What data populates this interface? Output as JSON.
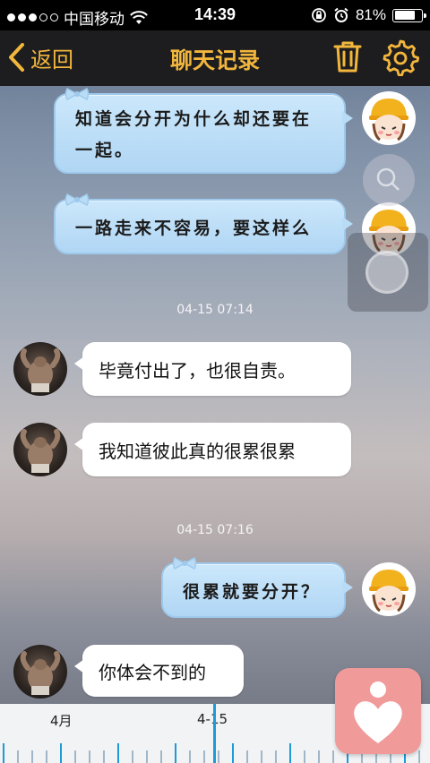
{
  "status_bar": {
    "carrier": "中国移动",
    "time": "14:39",
    "battery": "81%",
    "battery_level": 0.81
  },
  "nav": {
    "back_label": "返回",
    "title": "聊天记录"
  },
  "messages": [
    {
      "side": "right",
      "lines": [
        "知道会分开为什么却还要在",
        "一起。"
      ]
    },
    {
      "side": "right",
      "lines": [
        "一路走来不容易，要这样么"
      ]
    },
    {
      "side": "timestamp",
      "text": "04-15 07:14"
    },
    {
      "side": "left",
      "text": "毕竟付出了，也很自责。"
    },
    {
      "side": "left",
      "text": "我知道彼此真的很累很累"
    },
    {
      "side": "timestamp",
      "text": "04-15 07:16"
    },
    {
      "side": "right",
      "text": "很累就要分开？"
    },
    {
      "side": "left",
      "text": "你体会不到的"
    }
  ],
  "timeline": {
    "month_label": "4月",
    "date_label": "4-15"
  },
  "colors": {
    "accent": "#f2b63d",
    "nav_bg": "#1d1d1f",
    "bubble_right": "#b9dcf6",
    "timeline_cursor": "#1e9ad8",
    "heart_button": "#f09a9a"
  },
  "icons": {
    "back": "chevron-left-icon",
    "trash": "trash-icon",
    "settings": "gear-icon",
    "heart": "heart-icon",
    "search": "search-icon"
  }
}
